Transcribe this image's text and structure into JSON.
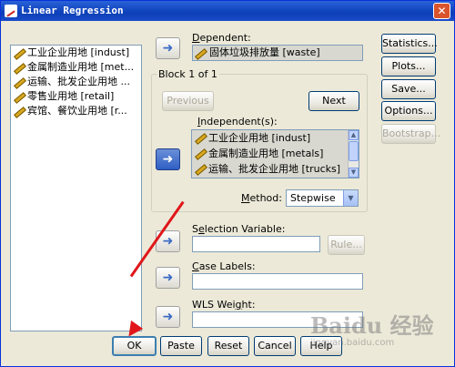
{
  "window": {
    "title": "Linear Regression",
    "close_glyph": "✕"
  },
  "variables": [
    "工业企业用地 [indust]",
    "金属制造业用地 [met...",
    "运输、批发企业用地 ...",
    "零售业用地 [retail]",
    "宾馆、餐饮业用地 [r..."
  ],
  "dependent": {
    "label_prefix": "",
    "label_hotkey": "D",
    "label_rest": "ependent:",
    "value": "固体垃圾排放量 [waste]"
  },
  "block": {
    "label": "Block 1 of 1",
    "previous_label": "Previous",
    "next_label": "Next",
    "independent_label_prefix": "",
    "independent_label_hotkey": "I",
    "independent_label_rest": "ndependent(s):",
    "independents": [
      "工业企业用地 [indust]",
      "金属制造业用地 [metals]",
      "运输、批发企业用地 [trucks]"
    ],
    "method_label_prefix": "",
    "method_label_hotkey": "M",
    "method_label_rest": "ethod:",
    "method_value": "Stepwise"
  },
  "selection_variable": {
    "label_prefix": "S",
    "label_hotkey": "e",
    "label_rest": "lection Variable:",
    "value": "",
    "rule_label": "Rule..."
  },
  "case_labels": {
    "label_prefix": "",
    "label_hotkey": "C",
    "label_rest": "ase Labels:",
    "value": ""
  },
  "wls_weight": {
    "label_prefix": "WLS Wei",
    "label_hotkey": "g",
    "label_rest": "ht:",
    "value": ""
  },
  "side_buttons": {
    "statistics": "Statistics...",
    "plots": "Plots...",
    "save": "Save...",
    "options": "Options...",
    "bootstrap": "Bootstrap..."
  },
  "bottom_buttons": {
    "ok": "OK",
    "paste": "Paste",
    "reset": "Reset",
    "cancel": "Cancel",
    "help": "Help"
  },
  "arrow_glyph": "➜",
  "watermark": {
    "main": "Baidu 经验",
    "sub": "jingyan.baidu.com"
  },
  "colors": {
    "titlebar": "#0c3fb8",
    "dialog": "#ece9d8",
    "annotation_arrow": "#e0161a"
  }
}
